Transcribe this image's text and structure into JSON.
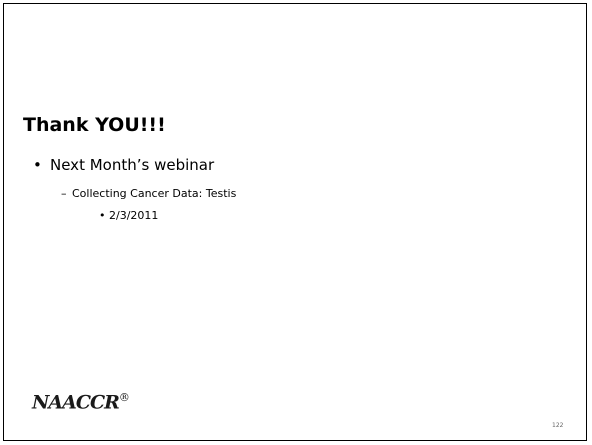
{
  "slide": {
    "title": "Thank YOU!!!",
    "bullet_level1": "Next Month’s webinar",
    "bullet_level2": "Collecting Cancer Data: Testis",
    "bullet_level3": "2/3/2011",
    "logo_text": "NAACCR",
    "logo_mark": "®",
    "page_number": "122"
  },
  "markers": {
    "bullet": "•",
    "dash": "–"
  }
}
